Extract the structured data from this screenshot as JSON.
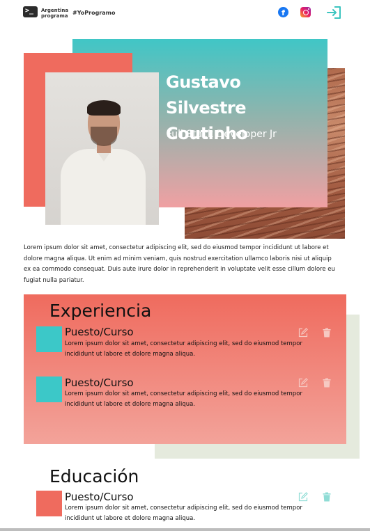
{
  "header": {
    "logo_glyph": ">_",
    "logo_line1": "Argentina",
    "logo_line2": "programa",
    "hashtag": "#YoProgramo",
    "facebook_glyph": "f",
    "icons": [
      "terminal-logo-icon",
      "facebook-icon",
      "instagram-icon",
      "login-icon"
    ]
  },
  "hero": {
    "name": "Gustavo Silvestre Coutinho",
    "role": "Full Stack Developer Jr"
  },
  "intro": "Lorem ipsum dolor sit amet, consectetur adipiscing elit, sed do eiusmod tempor incididunt ut labore et dolore magna aliqua. Ut enim ad minim veniam, quis nostrud exercitation ullamco laboris nisi ut aliquip ex ea commodo consequat. Duis aute irure dolor in reprehenderit in voluptate velit esse cillum dolore eu fugiat nulla pariatur.",
  "experiencia": {
    "title": "Experiencia",
    "items": [
      {
        "title": "Puesto/Curso",
        "description": "Lorem ipsum dolor sit amet, consectetur adipiscing elit, sed do eiusmod tempor incididunt ut labore et dolore magna aliqua."
      },
      {
        "title": "Puesto/Curso",
        "description": "Lorem ipsum dolor sit amet, consectetur adipiscing elit, sed do eiusmod tempor incididunt ut labore et dolore magna aliqua."
      }
    ]
  },
  "educacion": {
    "title": "Educación",
    "items": [
      {
        "title": "Puesto/Curso",
        "description": "Lorem ipsum dolor sit amet, consectetur adipiscing elit, sed do eiusmod tempor incididunt ut labore et dolore magna aliqua."
      }
    ]
  },
  "colors": {
    "coral": "#ef6b5e",
    "teal": "#40c6c6",
    "pink": "#f0a0a2",
    "sage": "#e5eadd",
    "icon_teal": "#4cc9c0"
  }
}
